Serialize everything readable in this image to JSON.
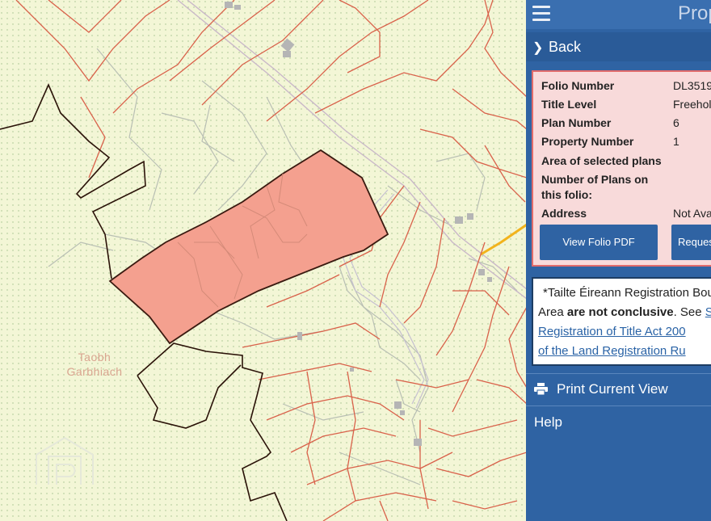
{
  "map": {
    "placename_line1": "Taobh",
    "placename_line2": "Garbhiach",
    "watermark_icon": "property-logo-icon",
    "colors": {
      "background": "#f3f6d6",
      "parcel_boundary": "#d9614a",
      "field_boundary": "#b9bfb4",
      "selected_fill": "#f4a08f",
      "selected_outline": "#3a1a10",
      "folio_outline": "#2a1208",
      "road": "#c9b8c8",
      "building": "#b5b5b5",
      "yellow_road": "#f2b31c"
    }
  },
  "panel": {
    "title": "Prop",
    "back_label": "Back",
    "info": {
      "folio_number_label": "Folio Number",
      "folio_number_value": "DL3519",
      "title_level_label": "Title Level",
      "title_level_value": "Freehol",
      "plan_number_label": "Plan Number",
      "plan_number_value": "6",
      "property_number_label": "Property Number",
      "property_number_value": "1",
      "area_label": "Area of selected plans",
      "plans_count_label_line1": "Number of Plans on",
      "plans_count_label_line2": "this folio:",
      "address_label": "Address",
      "address_value": "Not Ava"
    },
    "buttons": {
      "view_folio": "View Folio PDF",
      "request": "Reques"
    },
    "notice": {
      "line1": "*Tailte Éireann Registration Bou",
      "line2_before": "Area ",
      "line2_bold": "are not conclusive",
      "line2_after": ". See ",
      "line2_link": "S",
      "line3_link": "Registration of Title Act 200",
      "line4_link": "of the Land Registration Ru"
    },
    "print_label": "Print Current View",
    "help_label": "Help",
    "colors": {
      "panel_bg": "#2f63a3",
      "info_bg": "#f8dada",
      "info_border": "#e06b6b"
    }
  }
}
